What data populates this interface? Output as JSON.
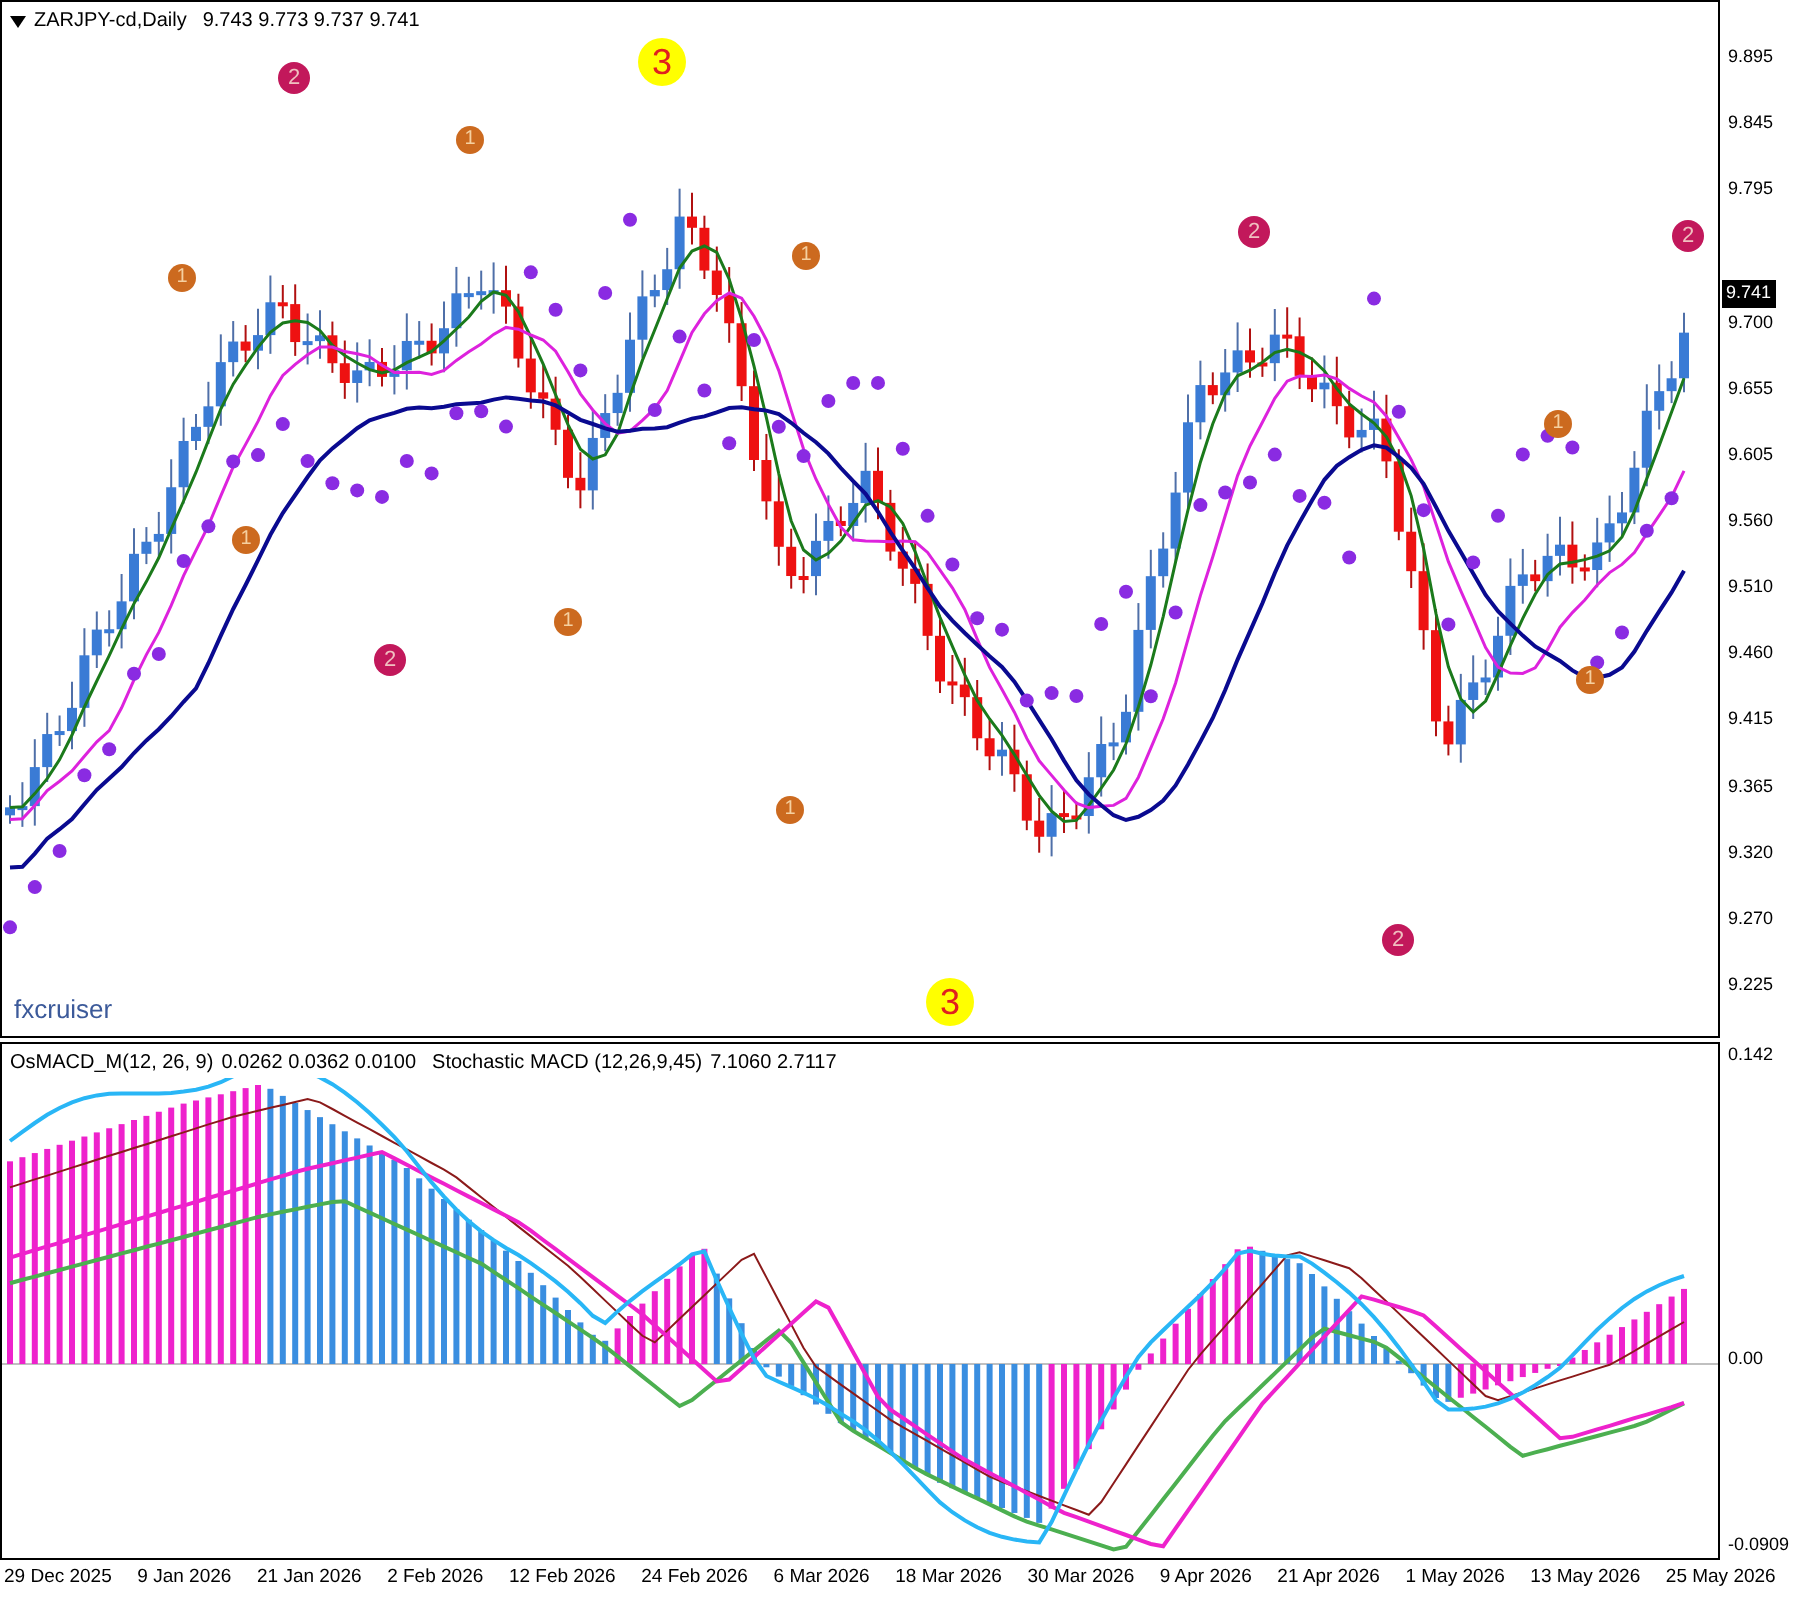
{
  "chart": {
    "symbol": "ZARJPY-cd,Daily",
    "ohlc": "9.743 9.773 9.737 9.741",
    "brand": "fxcruiser",
    "markers": [
      {
        "label": "3",
        "kind": "major"
      },
      {
        "label": "2",
        "kind": "medium"
      },
      {
        "label": "1",
        "kind": "minor"
      },
      {
        "label": "2",
        "kind": "medium"
      },
      {
        "label": "2",
        "kind": "medium"
      },
      {
        "label": "1",
        "kind": "minor"
      },
      {
        "label": "1",
        "kind": "minor"
      },
      {
        "label": "1",
        "kind": "minor"
      },
      {
        "label": "1",
        "kind": "minor"
      },
      {
        "label": "1",
        "kind": "minor"
      },
      {
        "label": "2",
        "kind": "medium"
      },
      {
        "label": "1",
        "kind": "minor"
      },
      {
        "label": "1",
        "kind": "minor"
      },
      {
        "label": "2",
        "kind": "medium"
      },
      {
        "label": "3",
        "kind": "major"
      }
    ],
    "price_axis": [
      "9.895",
      "9.845",
      "9.795",
      "9.700",
      "9.655",
      "9.605",
      "9.560",
      "9.510",
      "9.460",
      "9.415",
      "9.365",
      "9.320",
      "9.270",
      "9.225"
    ],
    "current_price": "9.741"
  },
  "indicator": {
    "items": [
      {
        "name": "OsMACD_M(12, 26, 9)",
        "values": "0.0262 0.0362 0.0100"
      },
      {
        "name": "Stochastic MACD (12,26,9,45)",
        "values": "7.1060 2.7117"
      }
    ],
    "axis": [
      "0.142",
      "0.00",
      "-0.0909"
    ]
  },
  "dates": [
    "29 Dec 2025",
    "9 Jan 2026",
    "21 Jan 2026",
    "2 Feb 2026",
    "12 Feb 2026",
    "24 Feb 2026",
    "6 Mar 2026",
    "18 Mar 2026",
    "30 Mar 2026",
    "9 Apr 2026",
    "21 Apr 2026",
    "1 May 2026",
    "13 May 2026",
    "25 May 2026"
  ]
}
